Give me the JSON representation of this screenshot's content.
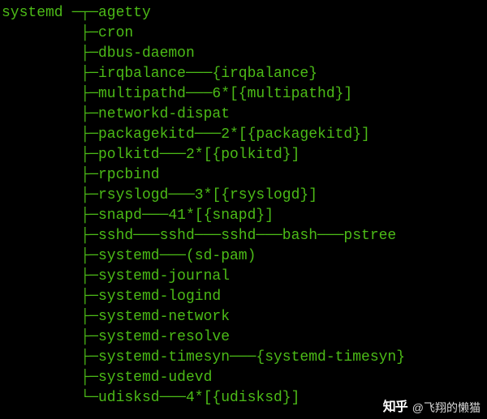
{
  "terminal": {
    "root": "systemd",
    "hbar": "───",
    "tee": "├─",
    "last": "└─",
    "mid_tee": "─┬─",
    "mid_last": "─┴─",
    "processes": [
      {
        "name": "agetty",
        "children": []
      },
      {
        "name": "cron",
        "children": []
      },
      {
        "name": "dbus-daemon",
        "children": []
      },
      {
        "name": "irqbalance",
        "children": [
          {
            "name": "{irqbalance}"
          }
        ]
      },
      {
        "name": "multipathd",
        "children": [
          {
            "name": "6*[{multipathd}]"
          }
        ]
      },
      {
        "name": "networkd-dispat",
        "children": []
      },
      {
        "name": "packagekitd",
        "children": [
          {
            "name": "2*[{packagekitd}]"
          }
        ]
      },
      {
        "name": "polkitd",
        "children": [
          {
            "name": "2*[{polkitd}]"
          }
        ]
      },
      {
        "name": "rpcbind",
        "children": []
      },
      {
        "name": "rsyslogd",
        "children": [
          {
            "name": "3*[{rsyslogd}]"
          }
        ]
      },
      {
        "name": "snapd",
        "children": [
          {
            "name": "41*[{snapd}]"
          }
        ]
      },
      {
        "name": "sshd",
        "children": [
          {
            "name": "sshd",
            "children": [
              {
                "name": "sshd",
                "children": [
                  {
                    "name": "bash",
                    "children": [
                      {
                        "name": "pstree"
                      }
                    ]
                  }
                ]
              }
            ]
          }
        ]
      },
      {
        "name": "systemd",
        "children": [
          {
            "name": "(sd-pam)"
          }
        ]
      },
      {
        "name": "systemd-journal",
        "children": []
      },
      {
        "name": "systemd-logind",
        "children": []
      },
      {
        "name": "systemd-network",
        "children": []
      },
      {
        "name": "systemd-resolve",
        "children": []
      },
      {
        "name": "systemd-timesyn",
        "children": [
          {
            "name": "{systemd-timesyn}"
          }
        ]
      },
      {
        "name": "systemd-udevd",
        "children": []
      },
      {
        "name": "udisksd",
        "children": [
          {
            "name": "4*[{udisksd}]"
          }
        ]
      }
    ]
  },
  "watermark": {
    "logo": "知乎",
    "author": "@飞翔的懒猫"
  }
}
